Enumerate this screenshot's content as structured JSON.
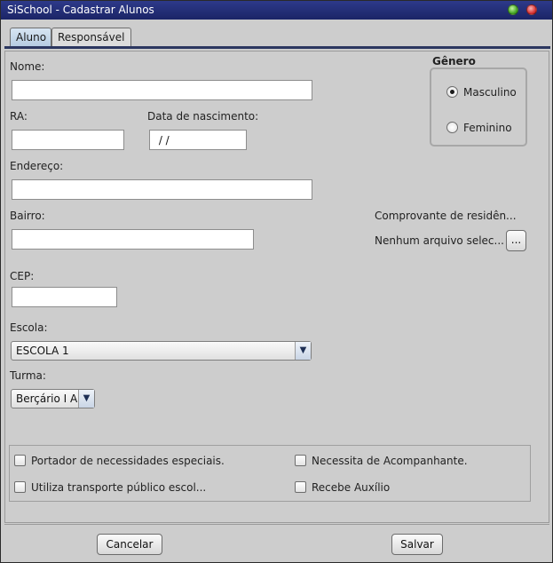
{
  "window": {
    "title": "SiSchool - Cadastrar Alunos"
  },
  "tabs": [
    {
      "label": "Aluno",
      "active": true
    },
    {
      "label": "Responsável",
      "active": false
    }
  ],
  "form": {
    "nome": {
      "label": "Nome:",
      "value": ""
    },
    "ra": {
      "label": "RA:",
      "value": ""
    },
    "data_nascimento": {
      "label": "Data de nascimento:",
      "value": " / /"
    },
    "endereco": {
      "label": "Endereço:",
      "value": ""
    },
    "bairro": {
      "label": "Bairro:",
      "value": ""
    },
    "cep": {
      "label": "CEP:",
      "value": ""
    },
    "escola": {
      "label": "Escola:",
      "selected": "ESCOLA 1"
    },
    "turma": {
      "label": "Turma:",
      "selected": "Berçário I A"
    }
  },
  "genero": {
    "title": "Gênero",
    "options": [
      {
        "label": "Masculino",
        "selected": true
      },
      {
        "label": "Feminino",
        "selected": false
      }
    ]
  },
  "comprovante": {
    "label": "Comprovante de residên...",
    "file_text": "Nenhum arquivo selec...",
    "browse_label": "..."
  },
  "checkboxes": [
    {
      "label": "Portador de necessidades especiais.",
      "checked": false
    },
    {
      "label": "Necessita de Acompanhante.",
      "checked": false
    },
    {
      "label": "Utiliza transporte público escol...",
      "checked": false
    },
    {
      "label": "Recebe Auxílio",
      "checked": false
    }
  ],
  "buttons": {
    "cancel": "Cancelar",
    "save": "Salvar"
  }
}
